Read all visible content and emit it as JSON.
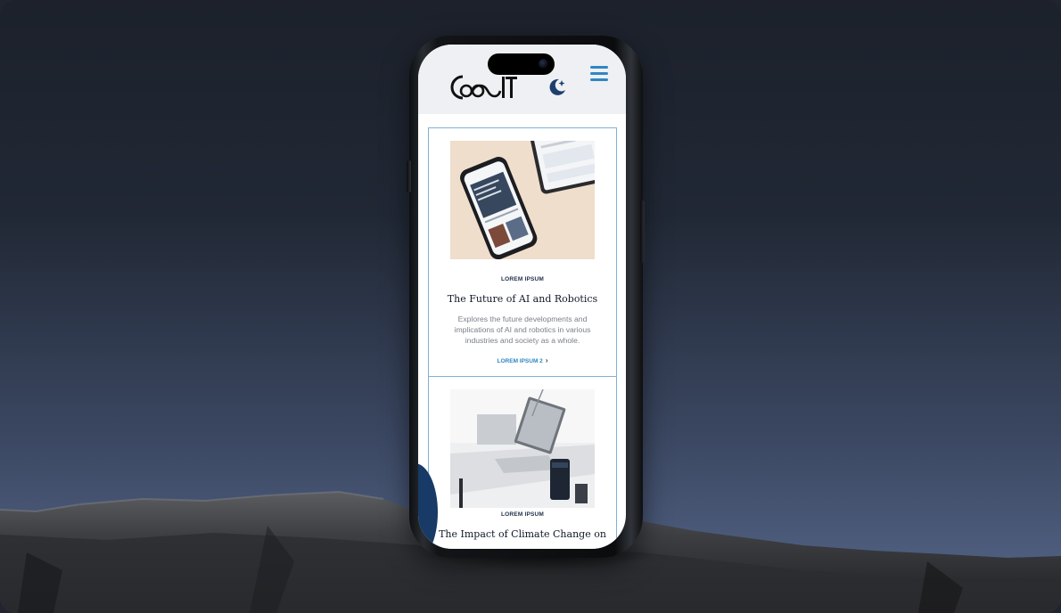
{
  "header": {
    "logo_alt": "COOIT",
    "theme_icon": "moon-star-icon",
    "menu_icon": "hamburger-menu-icon"
  },
  "articles": [
    {
      "category": "LOREM IPSUM",
      "title": "The Future of AI and Robotics",
      "description": "Explores the future developments and implications of AI and robotics in various industries and society as a whole.",
      "link_label": "LOREM IPSUM 2",
      "image": "phone-and-tablet-photo"
    },
    {
      "category": "LOREM IPSUM",
      "title": "The Impact of Climate Change on",
      "image": "desk-laptop-photo"
    }
  ],
  "colors": {
    "accent": "#2f86c4",
    "card_border": "#7fb0d8",
    "heading": "#111827",
    "body_text": "#7a7f88"
  }
}
